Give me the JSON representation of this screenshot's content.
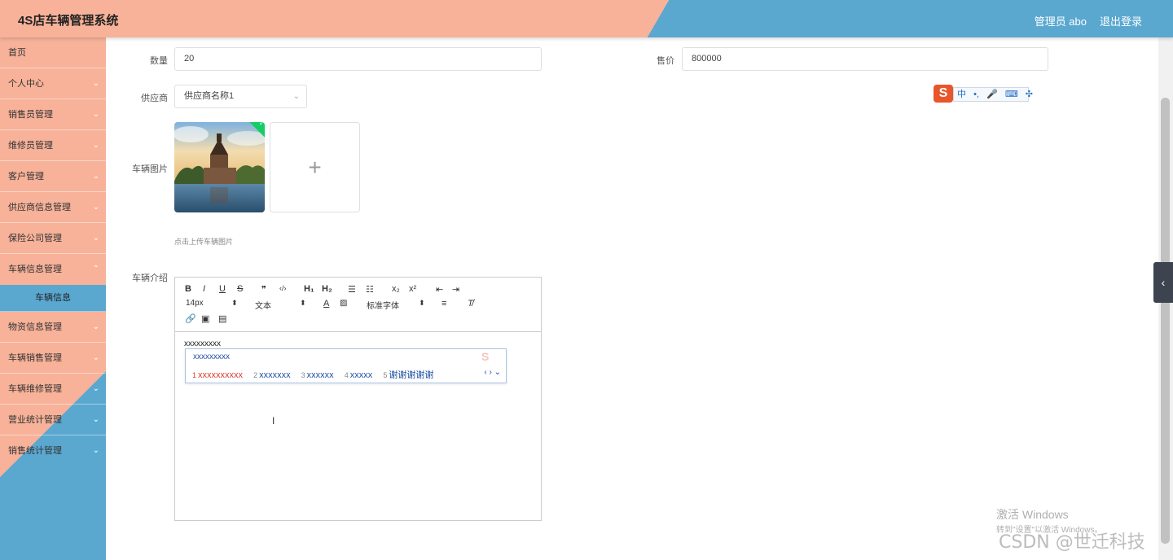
{
  "header": {
    "title": "4S店车辆管理系统",
    "user": "管理员 abo",
    "logout": "退出登录"
  },
  "sidebar": {
    "items": [
      {
        "label": "首页",
        "chevron": ""
      },
      {
        "label": "个人中心",
        "chevron": "⌄"
      },
      {
        "label": "销售员管理",
        "chevron": "⌄"
      },
      {
        "label": "维修员管理",
        "chevron": "⌄"
      },
      {
        "label": "客户管理",
        "chevron": "⌄"
      },
      {
        "label": "供应商信息管理",
        "chevron": "⌄"
      },
      {
        "label": "保险公司管理",
        "chevron": "⌄"
      },
      {
        "label": "车辆信息管理",
        "chevron": "⌃"
      },
      {
        "label": "车辆信息",
        "chevron": ""
      },
      {
        "label": "物资信息管理",
        "chevron": "⌄"
      },
      {
        "label": "车辆销售管理",
        "chevron": "⌄"
      },
      {
        "label": "车辆维修管理",
        "chevron": "⌄"
      },
      {
        "label": "营业统计管理",
        "chevron": "⌄"
      },
      {
        "label": "销售统计管理",
        "chevron": "⌄"
      }
    ]
  },
  "form": {
    "quantity_label": "数量",
    "quantity_value": "20",
    "price_label": "售价",
    "price_value": "800000",
    "supplier_label": "供应商",
    "supplier_value": "供应商名称1",
    "image_label": "车辆图片",
    "upload_plus": "+",
    "upload_hint": "点击上传车辆图片",
    "intro_label": "车辆介绍"
  },
  "editor": {
    "toolbar_row1": [
      "B",
      "I",
      "U",
      "S",
      "❞",
      "‹/›",
      "H₁",
      "H₂",
      "☰",
      "☷",
      "x₂",
      "x²",
      "⇤",
      "⇥"
    ],
    "font_size": "14px",
    "text_type": "文本",
    "font_family": "标准字体",
    "content": "xxxxxxxxx",
    "ime_composition": "xxxxxxxxx",
    "ime_candidates": [
      {
        "n": "1",
        "text": "xxxxxxxxxx"
      },
      {
        "n": "2",
        "text": "xxxxxxx"
      },
      {
        "n": "3",
        "text": "xxxxxx"
      },
      {
        "n": "4",
        "text": "xxxxx"
      },
      {
        "n": "5",
        "text": "谢谢谢谢谢"
      }
    ],
    "ime_nav": "‹ › ⌄"
  },
  "imebar": {
    "logo": "S",
    "items": [
      "中",
      "•,",
      "🎤",
      "⌨",
      "✣"
    ]
  },
  "watermark": {
    "line1": "激活 Windows",
    "line2": "转到\"设置\"以激活 Windows。",
    "csdn": "CSDN @世迁科技"
  },
  "colors": {
    "header_peach": "#f7b299",
    "header_blue": "#5aa8d0",
    "active_item": "#5aa8d0"
  }
}
